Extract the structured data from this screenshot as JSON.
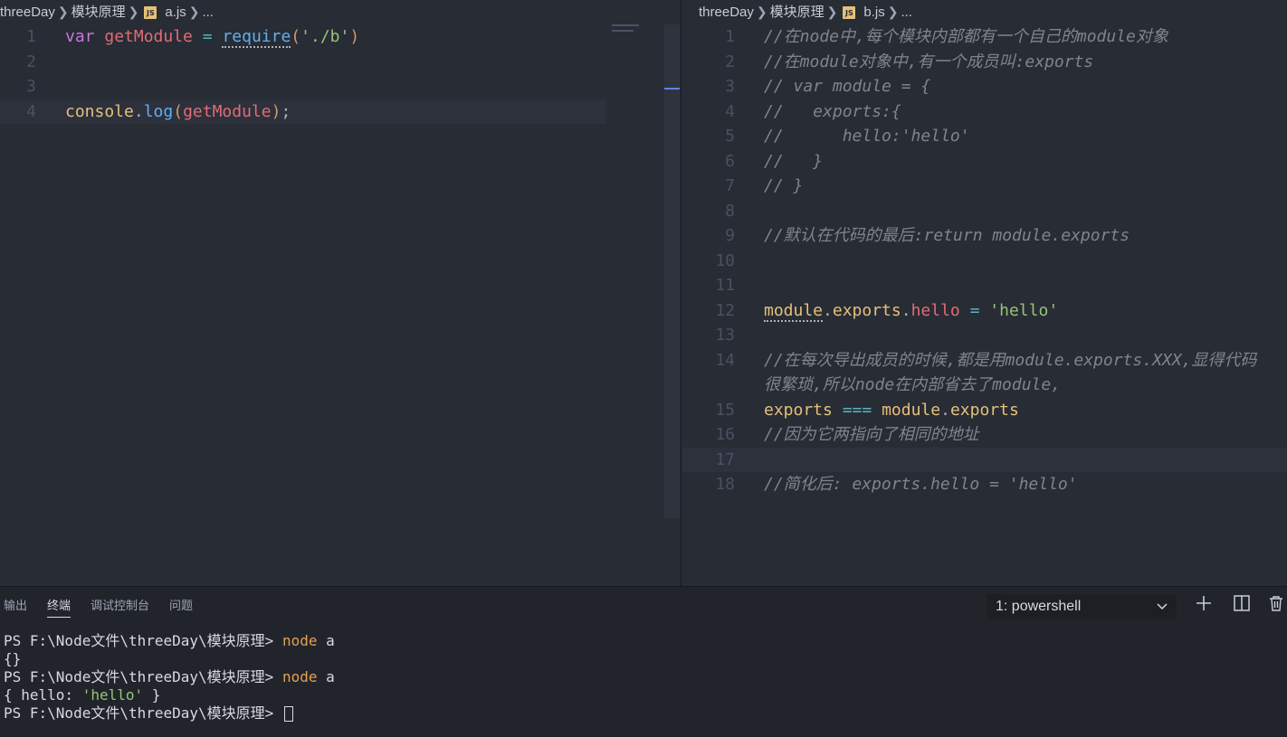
{
  "left_editor": {
    "breadcrumb": {
      "folder": "threeDay",
      "subfolder": "模块原理",
      "file": "a.js",
      "more": "..."
    },
    "lines": [
      {
        "num": "1",
        "tokens": [
          {
            "t": "var",
            "c": "kw"
          },
          {
            "t": " ",
            "c": "punc"
          },
          {
            "t": "getModule",
            "c": "var"
          },
          {
            "t": " ",
            "c": "punc"
          },
          {
            "t": "=",
            "c": "op"
          },
          {
            "t": " ",
            "c": "punc"
          },
          {
            "t": "require",
            "c": "fn dotted"
          },
          {
            "t": "(",
            "c": "par"
          },
          {
            "t": "'./b'",
            "c": "str"
          },
          {
            "t": ")",
            "c": "par"
          }
        ]
      },
      {
        "num": "2",
        "tokens": []
      },
      {
        "num": "3",
        "tokens": []
      },
      {
        "num": "4",
        "active": true,
        "tokens": [
          {
            "t": "console",
            "c": "obj"
          },
          {
            "t": ".",
            "c": "punc"
          },
          {
            "t": "log",
            "c": "fn"
          },
          {
            "t": "(",
            "c": "par"
          },
          {
            "t": "getModule",
            "c": "var"
          },
          {
            "t": ")",
            "c": "par"
          },
          {
            "t": ";",
            "c": "punc"
          }
        ]
      }
    ]
  },
  "right_editor": {
    "breadcrumb": {
      "folder": "threeDay",
      "subfolder": "模块原理",
      "file": "b.js",
      "more": "..."
    },
    "lines": [
      {
        "num": "1",
        "tokens": [
          {
            "t": "//在node中,每个模块内部都有一个自己的module对象",
            "c": "comment"
          }
        ]
      },
      {
        "num": "2",
        "tokens": [
          {
            "t": "//在module对象中,有一个成员叫:exports",
            "c": "comment"
          }
        ]
      },
      {
        "num": "3",
        "tokens": [
          {
            "t": "// var module = {",
            "c": "comment"
          }
        ]
      },
      {
        "num": "4",
        "tokens": [
          {
            "t": "//   exports:{",
            "c": "comment"
          }
        ]
      },
      {
        "num": "5",
        "tokens": [
          {
            "t": "//      hello:'hello'",
            "c": "comment"
          }
        ]
      },
      {
        "num": "6",
        "tokens": [
          {
            "t": "//   }",
            "c": "comment"
          }
        ]
      },
      {
        "num": "7",
        "tokens": [
          {
            "t": "// }",
            "c": "comment"
          }
        ]
      },
      {
        "num": "8",
        "tokens": []
      },
      {
        "num": "9",
        "tokens": [
          {
            "t": "//默认在代码的最后:return module.exports",
            "c": "comment"
          }
        ]
      },
      {
        "num": "10",
        "tokens": []
      },
      {
        "num": "11",
        "tokens": []
      },
      {
        "num": "12",
        "tokens": [
          {
            "t": "module",
            "c": "obj dotted"
          },
          {
            "t": ".",
            "c": "punc"
          },
          {
            "t": "exports",
            "c": "obj"
          },
          {
            "t": ".",
            "c": "punc"
          },
          {
            "t": "hello",
            "c": "var"
          },
          {
            "t": " ",
            "c": "punc"
          },
          {
            "t": "=",
            "c": "op"
          },
          {
            "t": " ",
            "c": "punc"
          },
          {
            "t": "'hello'",
            "c": "str"
          }
        ]
      },
      {
        "num": "13",
        "tokens": []
      },
      {
        "num": "14",
        "tokens": [
          {
            "t": "//在每次导出成员的时候,都是用module.exports.XXX,显得代码",
            "c": "comment"
          }
        ]
      },
      {
        "num": "",
        "wrap": true,
        "tokens": [
          {
            "t": "很繁琐,所以node在内部省去了module,",
            "c": "comment"
          }
        ]
      },
      {
        "num": "15",
        "tokens": [
          {
            "t": "exports",
            "c": "obj"
          },
          {
            "t": " ",
            "c": "punc"
          },
          {
            "t": "===",
            "c": "op"
          },
          {
            "t": " ",
            "c": "punc"
          },
          {
            "t": "module",
            "c": "obj"
          },
          {
            "t": ".",
            "c": "punc"
          },
          {
            "t": "exports",
            "c": "obj"
          }
        ]
      },
      {
        "num": "16",
        "tokens": [
          {
            "t": "//因为它两指向了相同的地址",
            "c": "comment"
          }
        ]
      },
      {
        "num": "17",
        "active": true,
        "tokens": []
      },
      {
        "num": "18",
        "tokens": [
          {
            "t": "//简化后: exports.hello = 'hello'",
            "c": "comment"
          }
        ]
      }
    ]
  },
  "panel": {
    "tabs": [
      {
        "label": "输出",
        "active": false
      },
      {
        "label": "终端",
        "active": true
      },
      {
        "label": "调试控制台",
        "active": false
      },
      {
        "label": "问题",
        "active": false
      }
    ],
    "terminal_select": "1: powershell",
    "terminal_lines": [
      [
        {
          "t": "PS F:\\Node文件\\threeDay\\模块原理> ",
          "c": ""
        },
        {
          "t": "node",
          "c": "t-cmd"
        },
        {
          "t": " a",
          "c": ""
        }
      ],
      [
        {
          "t": "{}",
          "c": ""
        }
      ],
      [
        {
          "t": "PS F:\\Node文件\\threeDay\\模块原理> ",
          "c": ""
        },
        {
          "t": "node",
          "c": "t-cmd"
        },
        {
          "t": " a",
          "c": ""
        }
      ],
      [
        {
          "t": "{ hello: ",
          "c": ""
        },
        {
          "t": "'hello'",
          "c": "t-str"
        },
        {
          "t": " }",
          "c": ""
        }
      ],
      [
        {
          "t": "PS F:\\Node文件\\threeDay\\模块原理> ",
          "c": ""
        }
      ]
    ]
  },
  "icons": {
    "breadcrumb_sep": "chevron-right-icon",
    "js_file": "js-file-icon",
    "add": "plus-icon",
    "split": "split-terminal-icon",
    "trash": "trash-icon"
  }
}
